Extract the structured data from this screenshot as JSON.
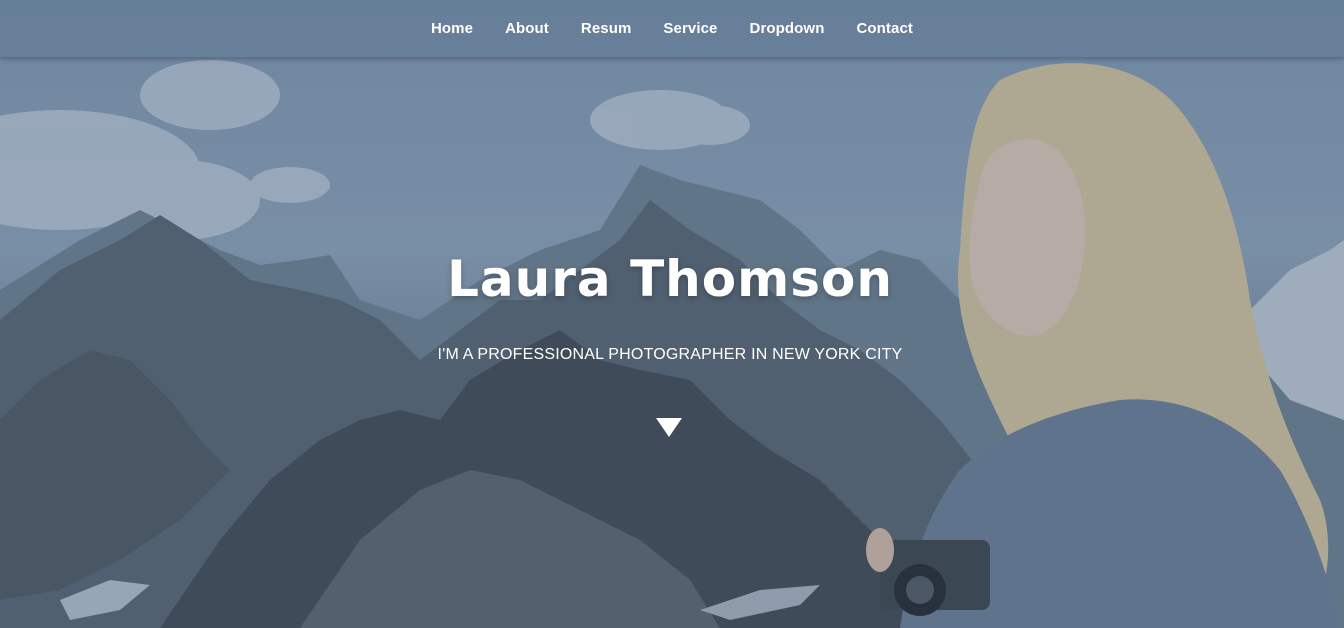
{
  "nav": {
    "items": [
      {
        "label": "Home"
      },
      {
        "label": "About"
      },
      {
        "label": "Resum"
      },
      {
        "label": "Service"
      },
      {
        "label": "Dropdown"
      },
      {
        "label": "Contact"
      }
    ]
  },
  "hero": {
    "title": "Laura Thomson",
    "subtitle": "I'M A PROFESSIONAL PHOTOGRAPHER IN NEW YORK CITY",
    "scroll_icon": "triangle-down"
  },
  "colors": {
    "nav_bg": "#647d96",
    "text": "#ffffff",
    "sky": "#8ea2b6"
  }
}
